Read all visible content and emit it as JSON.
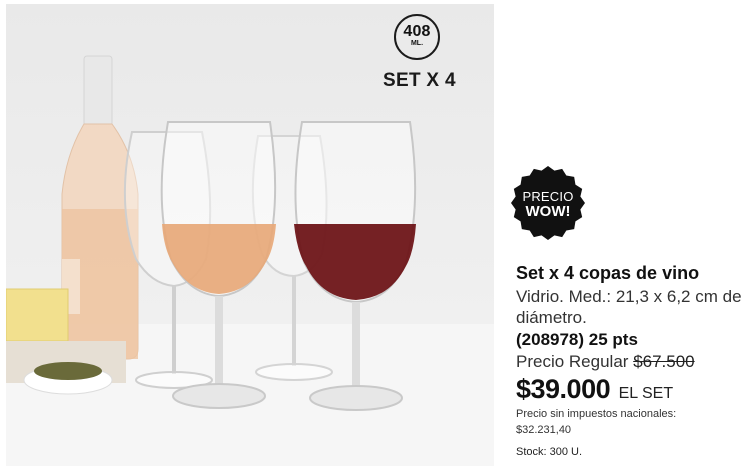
{
  "image": {
    "capacity_value": "408",
    "capacity_unit": "ML.",
    "set_label": "SET X 4"
  },
  "promo": {
    "line1": "PRECIO",
    "line2": "WOW!"
  },
  "product": {
    "title": "Set x 4 copas de vino",
    "description": "Vidrio. Med.: 21,3 x 6,2 cm de diámetro.",
    "code": "(208978) 25 pts",
    "regular_price_label": "Precio Regular",
    "regular_price": "$67.500",
    "offer_price": "$39.000",
    "offer_unit": "EL SET",
    "tax_note_label": "Precio sin impuestos nacionales:",
    "tax_note_value": "$32.231,40",
    "stock": "Stock: 300 U."
  },
  "colors": {
    "promo_badge": "#111111",
    "rose_wine": "#e7a878",
    "red_wine": "#6e1518",
    "background": "#ececec"
  }
}
